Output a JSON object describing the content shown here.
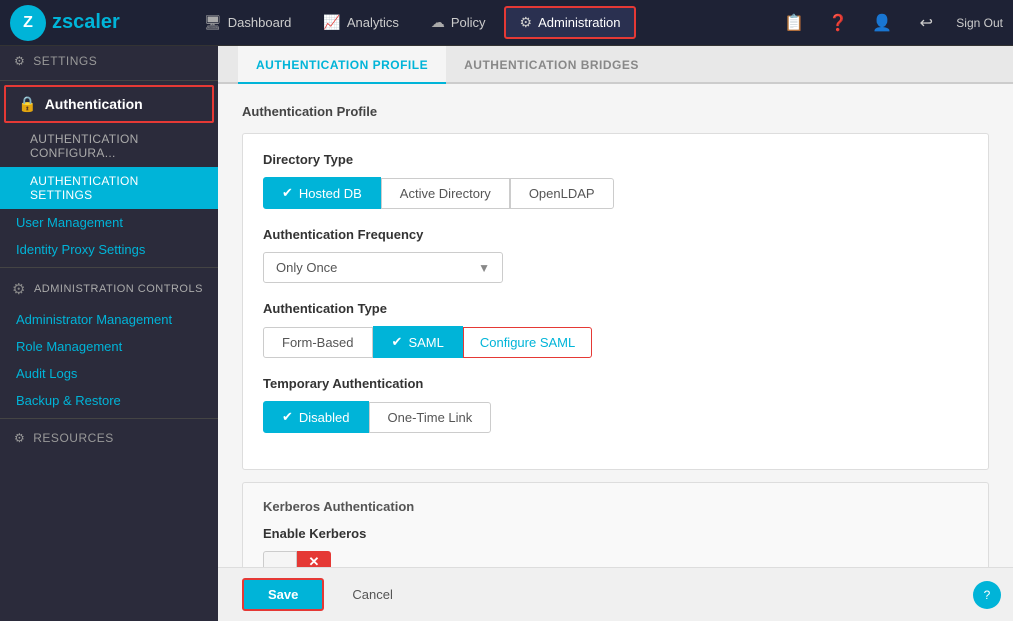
{
  "app": {
    "title": "Zscaler"
  },
  "topnav": {
    "logo_letter": "Z",
    "items": [
      {
        "id": "dashboard",
        "label": "Dashboard",
        "icon": "🖥"
      },
      {
        "id": "analytics",
        "label": "Analytics",
        "icon": "📈"
      },
      {
        "id": "policy",
        "label": "Policy",
        "icon": "☁"
      },
      {
        "id": "administration",
        "label": "Administration",
        "icon": "⚙",
        "active": true
      }
    ],
    "sign_out": "Sign Out"
  },
  "sidebar": {
    "settings_label": "Settings",
    "auth_label": "Authentication",
    "auth_config_label": "AUTHENTICATION CONFIGURA...",
    "auth_settings_label": "Authentication Settings",
    "user_management_label": "User Management",
    "identity_proxy_label": "Identity Proxy Settings",
    "admin_controls_label": "ADMINISTRATION CONTROLS",
    "admin_management_label": "Administrator Management",
    "role_management_label": "Role Management",
    "audit_logs_label": "Audit Logs",
    "backup_restore_label": "Backup & Restore",
    "resources_label": "Resources"
  },
  "tabs": [
    {
      "id": "profile",
      "label": "Authentication Profile",
      "active": true
    },
    {
      "id": "bridges",
      "label": "Authentication Bridges",
      "active": false
    }
  ],
  "content": {
    "auth_profile_title": "Authentication Profile",
    "directory_type_label": "Directory Type",
    "directory_options": [
      {
        "id": "hosted-db",
        "label": "Hosted DB",
        "active": true
      },
      {
        "id": "active-directory",
        "label": "Active Directory",
        "active": false
      },
      {
        "id": "openldap",
        "label": "OpenLDAP",
        "active": false
      }
    ],
    "auth_frequency_label": "Authentication Frequency",
    "auth_frequency_value": "Only Once",
    "auth_type_label": "Authentication Type",
    "auth_type_options": [
      {
        "id": "form-based",
        "label": "Form-Based",
        "active": false
      },
      {
        "id": "saml",
        "label": "SAML",
        "active": true
      },
      {
        "id": "configure-saml",
        "label": "Configure SAML",
        "special": true
      }
    ],
    "temp_auth_label": "Temporary Authentication",
    "temp_auth_options": [
      {
        "id": "disabled",
        "label": "Disabled",
        "active": true
      },
      {
        "id": "one-time-link",
        "label": "One-Time Link",
        "active": false
      }
    ],
    "kerberos_section_title": "Kerberos Authentication",
    "kerberos_enable_label": "Enable Kerberos",
    "kerberos_toggle_state": "off"
  },
  "footer": {
    "save_label": "Save",
    "cancel_label": "Cancel"
  }
}
